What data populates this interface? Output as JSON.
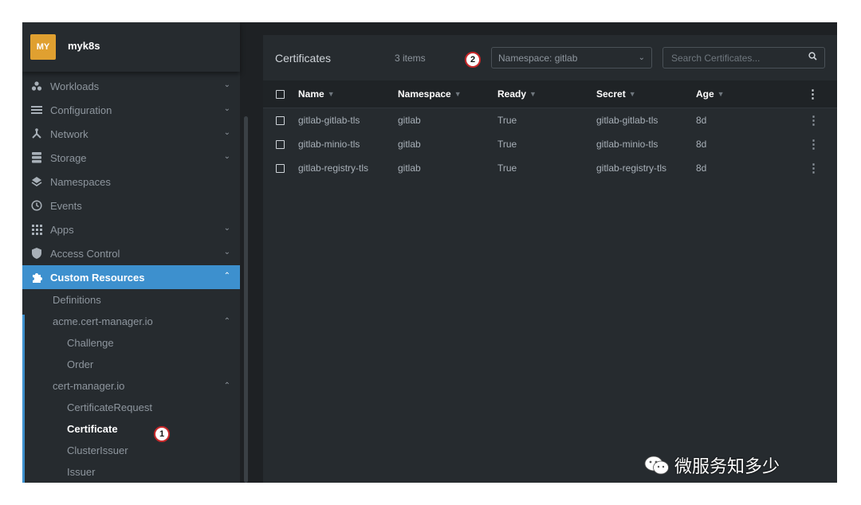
{
  "cluster": {
    "avatar": "MY",
    "name": "myk8s"
  },
  "nav": {
    "workloads": "Workloads",
    "configuration": "Configuration",
    "network": "Network",
    "storage": "Storage",
    "namespaces": "Namespaces",
    "events": "Events",
    "apps": "Apps",
    "access_control": "Access Control",
    "custom_resources": "Custom Resources",
    "definitions": "Definitions",
    "group1": "acme.cert-manager.io",
    "challenge": "Challenge",
    "order": "Order",
    "group2": "cert-manager.io",
    "certificate_request": "CertificateRequest",
    "certificate": "Certificate",
    "cluster_issuer": "ClusterIssuer",
    "issuer": "Issuer"
  },
  "main": {
    "title": "Certificates",
    "count": "3 items",
    "namespace_select": "Namespace: gitlab",
    "search_placeholder": "Search Certificates..."
  },
  "table": {
    "columns": {
      "name": "Name",
      "namespace": "Namespace",
      "ready": "Ready",
      "secret": "Secret",
      "age": "Age"
    },
    "rows": [
      {
        "name": "gitlab-gitlab-tls",
        "namespace": "gitlab",
        "ready": "True",
        "secret": "gitlab-gitlab-tls",
        "age": "8d"
      },
      {
        "name": "gitlab-minio-tls",
        "namespace": "gitlab",
        "ready": "True",
        "secret": "gitlab-minio-tls",
        "age": "8d"
      },
      {
        "name": "gitlab-registry-tls",
        "namespace": "gitlab",
        "ready": "True",
        "secret": "gitlab-registry-tls",
        "age": "8d"
      }
    ]
  },
  "annotations": {
    "marker1": "1",
    "marker2": "2"
  },
  "watermark": "微服务知多少",
  "colors": {
    "accent": "#3d90ce",
    "avatar": "#e0a030",
    "marker_border": "#c8282a"
  },
  "icons": [
    "workloads-icon",
    "configuration-icon",
    "network-icon",
    "storage-icon",
    "namespaces-icon",
    "events-icon",
    "apps-icon",
    "access-control-icon",
    "custom-resources-icon",
    "search-icon",
    "chevron-down-icon",
    "chevron-up-icon",
    "kebab-menu-icon",
    "wechat-icon"
  ]
}
